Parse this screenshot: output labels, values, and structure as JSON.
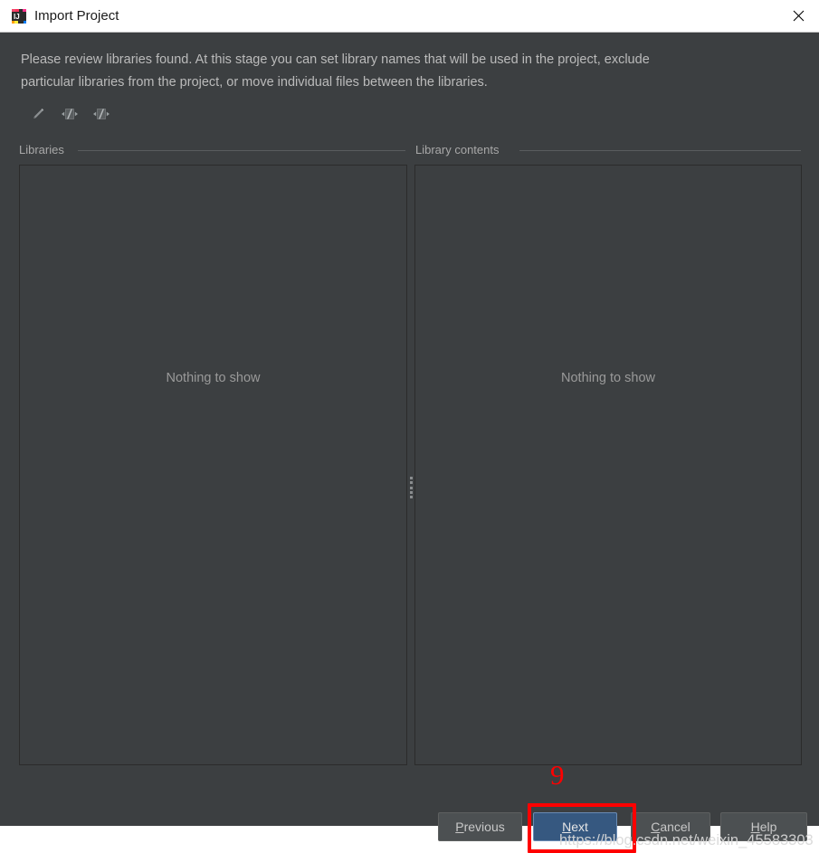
{
  "window": {
    "title": "Import Project",
    "app_icon": "intellij-idea-icon",
    "close_icon": "close-icon",
    "background_color": "#3c3f41",
    "titlebar_color": "#ffffff"
  },
  "intro": {
    "text": "Please review libraries found. At this stage you can set library names that will be used in the project, exclude particular libraries from the project, or move individual files between the libraries."
  },
  "toolbar": {
    "buttons": [
      {
        "name": "rename-library-button",
        "icon": "pencil-icon",
        "label": ""
      },
      {
        "name": "merge-libraries-button",
        "icon": "merge-arrows-icon",
        "label": ""
      },
      {
        "name": "split-library-button",
        "icon": "split-arrows-icon",
        "label": ""
      }
    ]
  },
  "panels": {
    "libraries": {
      "label": "Libraries",
      "empty_text": "Nothing to show"
    },
    "contents": {
      "label": "Library contents",
      "empty_text": "Nothing to show"
    }
  },
  "splitter": {
    "name": "panel-splitter"
  },
  "buttons": {
    "previous": {
      "mnemonic": "P",
      "rest": "revious"
    },
    "next": {
      "mnemonic": "N",
      "rest": "ext"
    },
    "cancel": {
      "mnemonic": "C",
      "rest": "ancel"
    },
    "help": {
      "mnemonic": "H",
      "rest": "elp"
    }
  },
  "annotations": {
    "step_number": "9",
    "highlight_color": "#ff0000",
    "watermark": "https://blog.csdn.net/weixin_45583303"
  }
}
